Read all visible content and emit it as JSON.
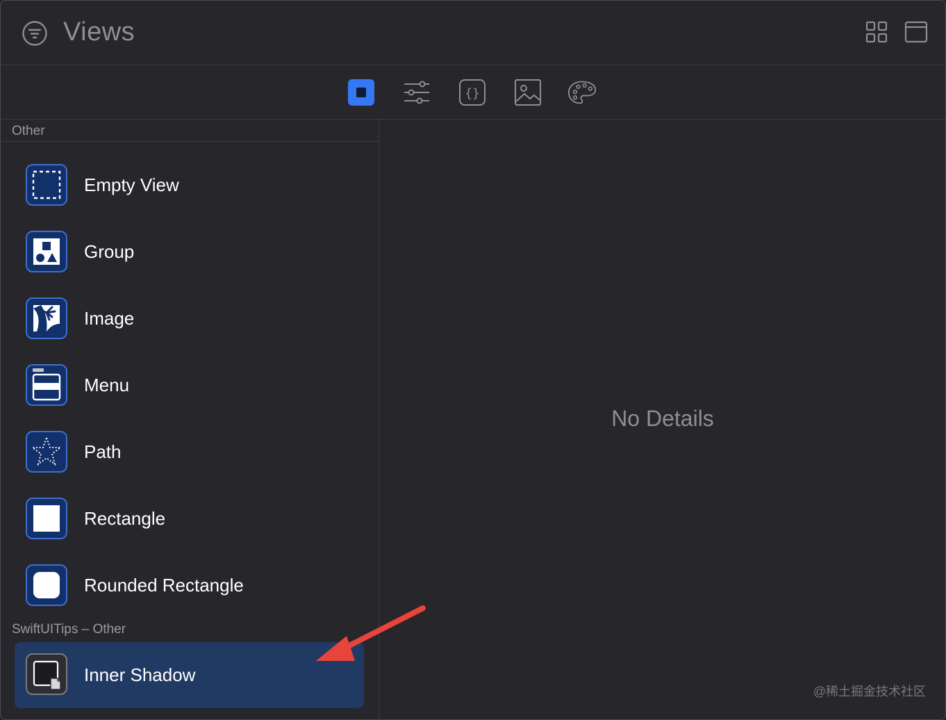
{
  "header": {
    "title": "Views",
    "filter_icon": "filter-circle-icon",
    "grid_icon": "grid-icon",
    "panel_icon": "panel-icon"
  },
  "tabs": [
    {
      "icon": "views-icon",
      "selected": true
    },
    {
      "icon": "modifiers-icon",
      "selected": false
    },
    {
      "icon": "snippets-icon",
      "selected": false
    },
    {
      "icon": "media-icon",
      "selected": false
    },
    {
      "icon": "colors-icon",
      "selected": false
    }
  ],
  "sidebar": {
    "section_other": "Other",
    "items": [
      {
        "label": "Empty View",
        "icon": "empty-view-icon"
      },
      {
        "label": "Group",
        "icon": "group-icon"
      },
      {
        "label": "Image",
        "icon": "image-icon"
      },
      {
        "label": "Menu",
        "icon": "menu-icon"
      },
      {
        "label": "Path",
        "icon": "path-star-icon"
      },
      {
        "label": "Rectangle",
        "icon": "rectangle-icon"
      },
      {
        "label": "Rounded Rectangle",
        "icon": "rounded-rectangle-icon"
      }
    ],
    "section_swiftuitips": "SwiftUITips – Other",
    "tips_items": [
      {
        "label": "Inner Shadow",
        "icon": "inner-shadow-icon",
        "selected": true
      }
    ]
  },
  "detail": {
    "empty_text": "No Details"
  },
  "watermark": "@稀土掘金技术社区",
  "colors": {
    "accent": "#3478f6",
    "arrow": "#e8443a",
    "selected_row": "#213a64"
  }
}
